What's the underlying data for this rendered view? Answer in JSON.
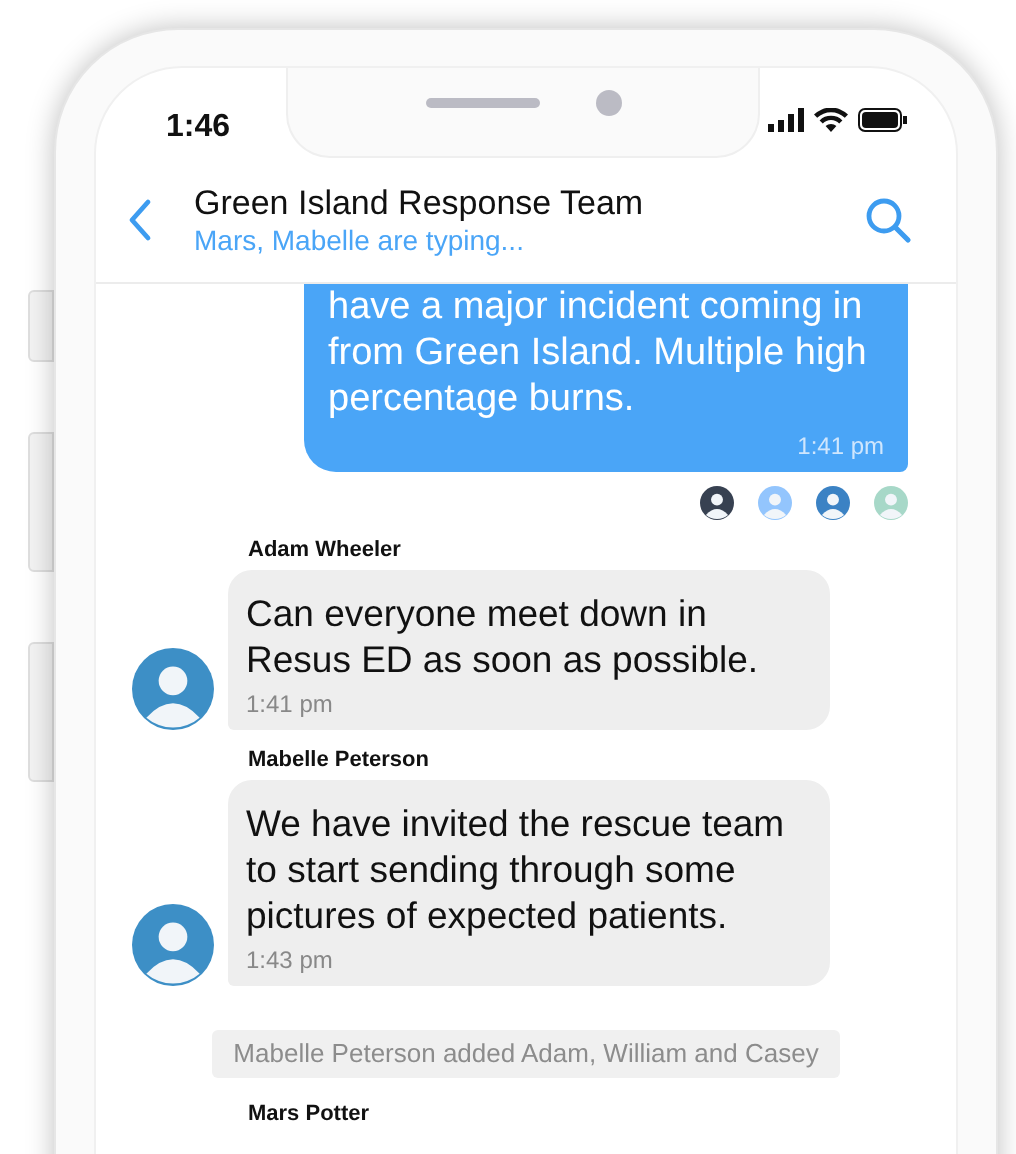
{
  "status_bar": {
    "time": "1:46"
  },
  "header": {
    "title": "Green Island Response Team",
    "subtitle": "Mars, Mabelle are typing..."
  },
  "messages": [
    {
      "kind": "outgoing",
      "text": "have a major incident coming in from Green Island. Multiple high percentage burns.",
      "time": "1:41 pm"
    },
    {
      "kind": "incoming",
      "sender": "Adam Wheeler",
      "text": "Can everyone meet down in Resus ED as soon as possible.",
      "time": "1:41 pm"
    },
    {
      "kind": "incoming",
      "sender": "Mabelle Peterson",
      "text": "We have invited the rescue team to start sending through some pictures of expected patients.",
      "time": "1:43 pm"
    },
    {
      "kind": "system",
      "text": "Mabelle Peterson added Adam, William and Casey"
    },
    {
      "kind": "sender_only",
      "sender": "Mars Potter"
    }
  ]
}
